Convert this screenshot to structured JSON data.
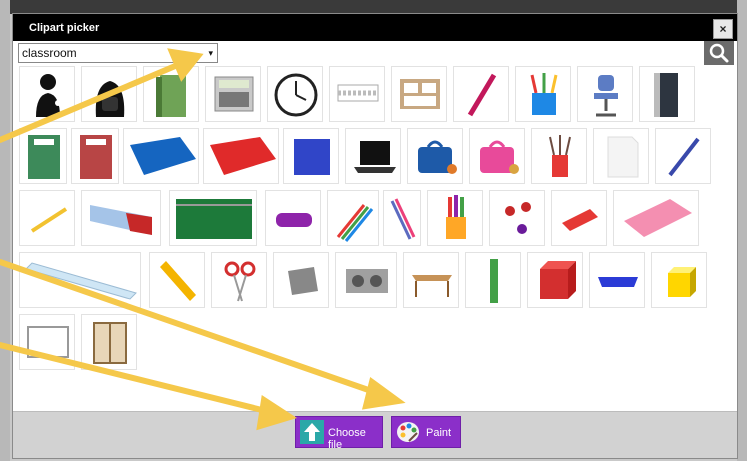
{
  "dialog": {
    "title": "Clipart picker",
    "close_label": "×"
  },
  "search": {
    "selected": "classroom",
    "caret": "▾"
  },
  "footer": {
    "choose_file_label": "Choose file",
    "paint_label": "Paint"
  },
  "icons": {
    "search": "search-icon",
    "upload": "upload-icon",
    "palette": "palette-icon"
  },
  "colors": {
    "titlebar": "#000000",
    "button_purple": "#8b2fc9",
    "arrow": "#f5c84a"
  }
}
